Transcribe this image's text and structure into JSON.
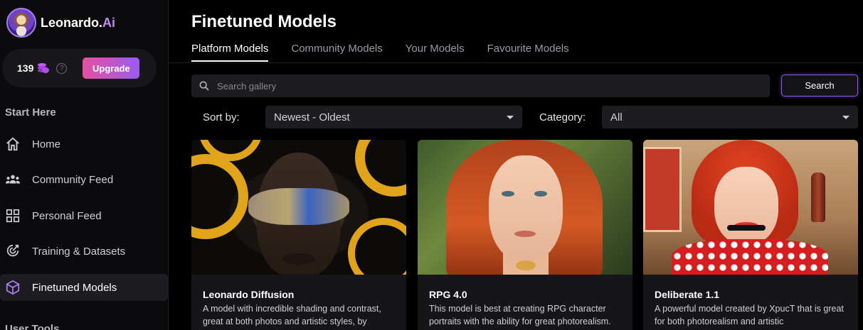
{
  "brand": {
    "name": "Leonardo.",
    "name_suffix": "Ai"
  },
  "account": {
    "tokens": "139",
    "help_symbol": "?",
    "upgrade_label": "Upgrade"
  },
  "sidebar": {
    "section_start": "Start Here",
    "items": [
      {
        "label": "Home",
        "icon": "home-icon"
      },
      {
        "label": "Community Feed",
        "icon": "people-icon"
      },
      {
        "label": "Personal Feed",
        "icon": "grid-icon"
      },
      {
        "label": "Training & Datasets",
        "icon": "training-icon"
      },
      {
        "label": "Finetuned Models",
        "icon": "cube-icon",
        "active": true
      }
    ],
    "section_user": "User Tools"
  },
  "main": {
    "title": "Finetuned Models",
    "tabs": [
      {
        "label": "Platform Models",
        "active": true
      },
      {
        "label": "Community Models"
      },
      {
        "label": "Your Models"
      },
      {
        "label": "Favourite Models"
      }
    ],
    "search": {
      "placeholder": "Search gallery",
      "value": "",
      "button_label": "Search"
    },
    "sort": {
      "label": "Sort by:",
      "value": "Newest - Oldest"
    },
    "category": {
      "label": "Category:",
      "value": "All"
    },
    "cards": [
      {
        "title": "Leonardo Diffusion",
        "description": "A model with incredible shading and contrast, great at both photos and artistic styles, by"
      },
      {
        "title": "RPG 4.0",
        "description": "This model is best at creating RPG character portraits with the ability for great photorealism."
      },
      {
        "title": "Deliberate 1.1",
        "description": "A powerful model created by XpucT that is great for both photorealism and artistic"
      }
    ]
  },
  "colors": {
    "background": "#000000",
    "sidebar_bg": "#0b0b0d",
    "accent_purple": "#9a5cf0",
    "upgrade_gradient_start": "#e64fa0",
    "brand_ai": "#c38af5"
  }
}
